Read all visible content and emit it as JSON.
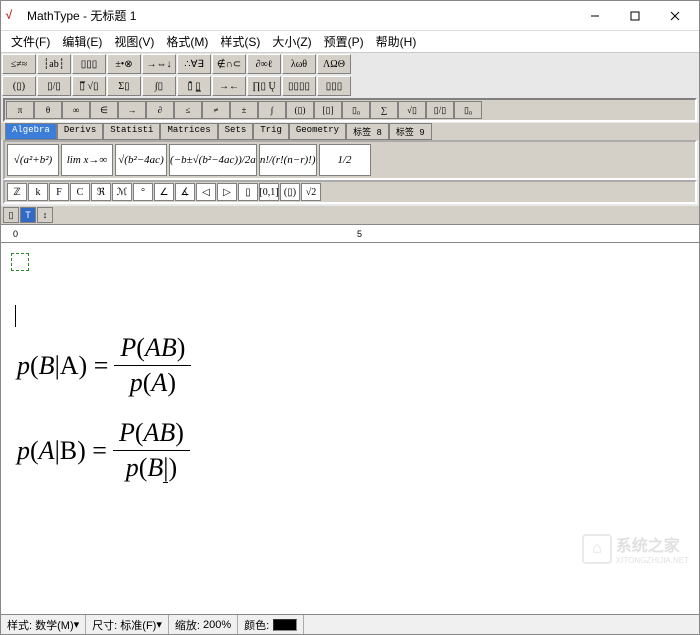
{
  "title": "MathType - 无标题 1",
  "menus": [
    "文件(F)",
    "编辑(E)",
    "视图(V)",
    "格式(M)",
    "样式(S)",
    "大小(Z)",
    "预置(P)",
    "帮助(H)"
  ],
  "palette_row1": [
    "≤≠≈",
    "┆ab┆",
    "▯▯▯",
    "±•⊗",
    "→⇔↓",
    "∴∀∃",
    "∉∩⊂",
    "∂∞ℓ",
    "λωθ",
    "ΛΩΘ"
  ],
  "palette_row2": [
    "(▯)",
    "▯/▯",
    "▯̅ √▯",
    "Σ▯",
    "∫▯",
    "▯̄ ▯̲",
    "→←",
    "∏▯ Ų",
    "▯▯▯▯",
    "▯▯▯"
  ],
  "template_row": [
    "π",
    "θ",
    "∞",
    "∈",
    "→",
    "∂",
    "≤",
    "≠",
    "±",
    "∫",
    "(▯)",
    "[▯]",
    "▯₀",
    "∑",
    "√▯",
    "▯/▯",
    "▯₀"
  ],
  "tabs": [
    {
      "label": "Algebra",
      "active": true
    },
    {
      "label": "Derivs",
      "active": false
    },
    {
      "label": "Statisti",
      "active": false
    },
    {
      "label": "Matrices",
      "active": false
    },
    {
      "label": "Sets",
      "active": false
    },
    {
      "label": "Trig",
      "active": false
    },
    {
      "label": "Geometry",
      "active": false
    },
    {
      "label": "标签 8",
      "active": false
    },
    {
      "label": "标签 9",
      "active": false
    }
  ],
  "samples": [
    "√(a²+b²)",
    "lim x→∞",
    "√(b²−4ac)",
    "(−b±√(b²−4ac))/2a",
    "n!/(r!(n−r)!)",
    "1/2"
  ],
  "small_cells": [
    "ℤ",
    "k",
    "F",
    "C",
    "ℜ",
    "ℳ",
    "°",
    "∠",
    "∡",
    "◁",
    "▷",
    "▯",
    "[0,1]",
    "(▯)",
    "√2"
  ],
  "ruler": {
    "marks": [
      "0",
      "5"
    ]
  },
  "equations": [
    {
      "lhs": "p(B|A) =",
      "num": "P(AB)",
      "den": "p(A)"
    },
    {
      "lhs": "p(A|B) =",
      "num": "P(AB)",
      "den": "p(B|"
    }
  ],
  "watermark": "系统之家",
  "watermark_sub": "XITONGZHIJIA.NET",
  "status": {
    "style_label": "样式:",
    "style_val": "数学(M)",
    "size_label": "尺寸:",
    "size_val": "标准(F)",
    "zoom_label": "缩放:",
    "zoom_val": "200%",
    "color_label": "颜色:"
  }
}
